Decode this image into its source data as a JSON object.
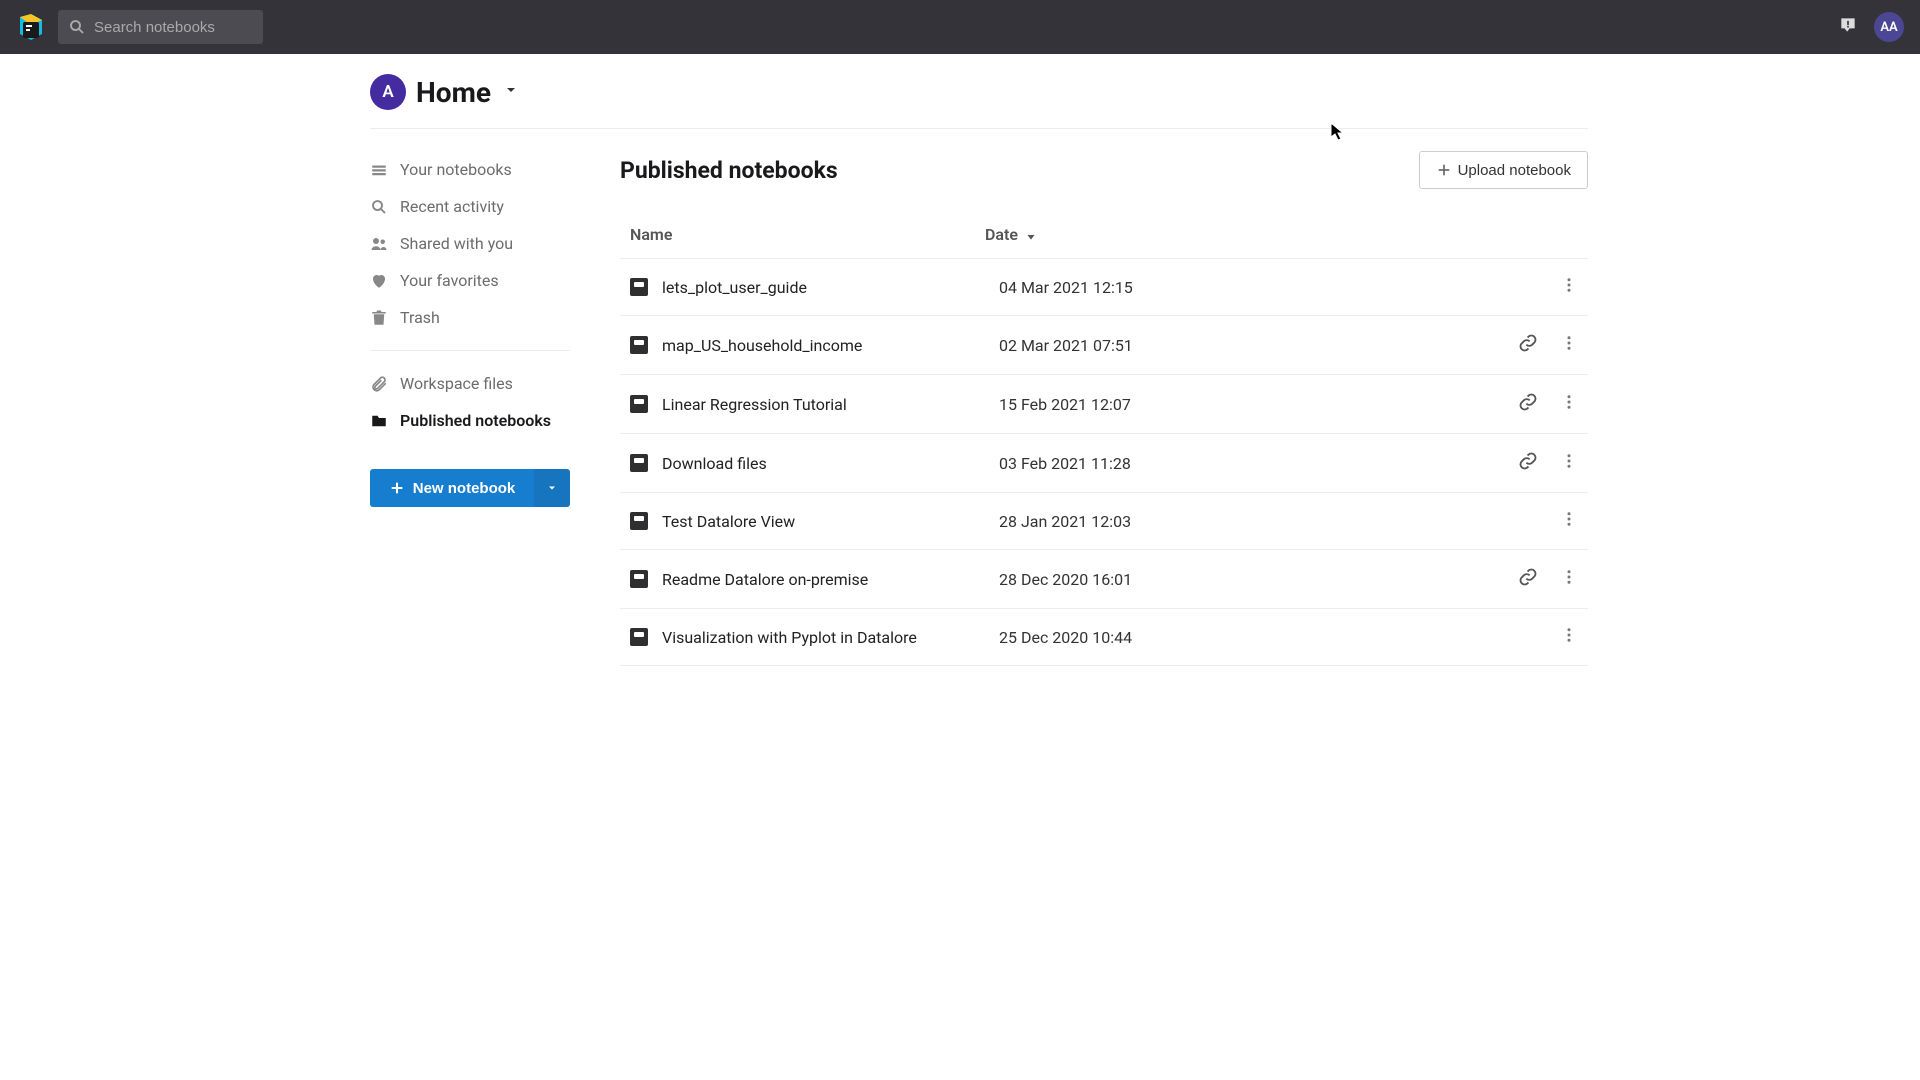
{
  "topbar": {
    "search_placeholder": "Search notebooks",
    "avatar_initials": "AA"
  },
  "header": {
    "avatar_letter": "A",
    "title": "Home"
  },
  "sidebar": {
    "items": [
      {
        "id": "your-notebooks",
        "label": "Your notebooks",
        "icon": "stack"
      },
      {
        "id": "recent-activity",
        "label": "Recent activity",
        "icon": "clock"
      },
      {
        "id": "shared-with-you",
        "label": "Shared with you",
        "icon": "people"
      },
      {
        "id": "your-favorites",
        "label": "Your favorites",
        "icon": "heart"
      },
      {
        "id": "trash",
        "label": "Trash",
        "icon": "trash"
      }
    ],
    "footer_items": [
      {
        "id": "workspace-files",
        "label": "Workspace files",
        "icon": "paperclip"
      },
      {
        "id": "published-notebooks",
        "label": "Published notebooks",
        "icon": "folder",
        "active": true
      }
    ],
    "new_button_label": "New notebook"
  },
  "main": {
    "title": "Published notebooks",
    "upload_label": "Upload notebook",
    "columns": {
      "name": "Name",
      "date": "Date"
    },
    "rows": [
      {
        "name": "lets_plot_user_guide",
        "date": "04 Mar 2021 12:15",
        "has_link": false
      },
      {
        "name": "map_US_household_income",
        "date": "02 Mar 2021 07:51",
        "has_link": true
      },
      {
        "name": "Linear Regression Tutorial",
        "date": "15 Feb 2021 12:07",
        "has_link": true
      },
      {
        "name": "Download files",
        "date": "03 Feb 2021 11:28",
        "has_link": true
      },
      {
        "name": "Test Datalore View",
        "date": "28 Jan 2021 12:03",
        "has_link": false
      },
      {
        "name": "Readme Datalore on-premise",
        "date": "28 Dec 2020 16:01",
        "has_link": true
      },
      {
        "name": "Visualization with Pyplot in Datalore",
        "date": "25 Dec 2020 10:44",
        "has_link": false
      }
    ]
  }
}
